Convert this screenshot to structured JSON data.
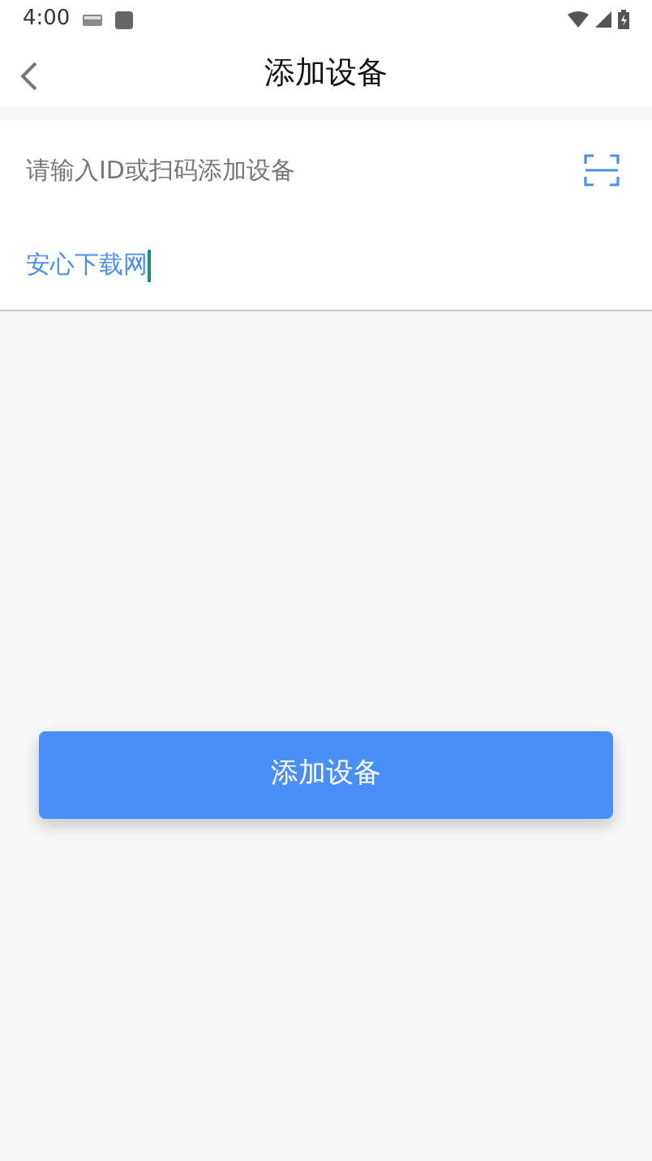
{
  "status_bar": {
    "time": "4:00"
  },
  "header": {
    "title": "添加设备"
  },
  "fields": [
    {
      "kind": "scan",
      "placeholder": "请输入ID或扫码添加设备"
    },
    {
      "kind": "text",
      "value": "安心下载网",
      "focused": true
    }
  ],
  "button": {
    "label": "添加设备"
  }
}
